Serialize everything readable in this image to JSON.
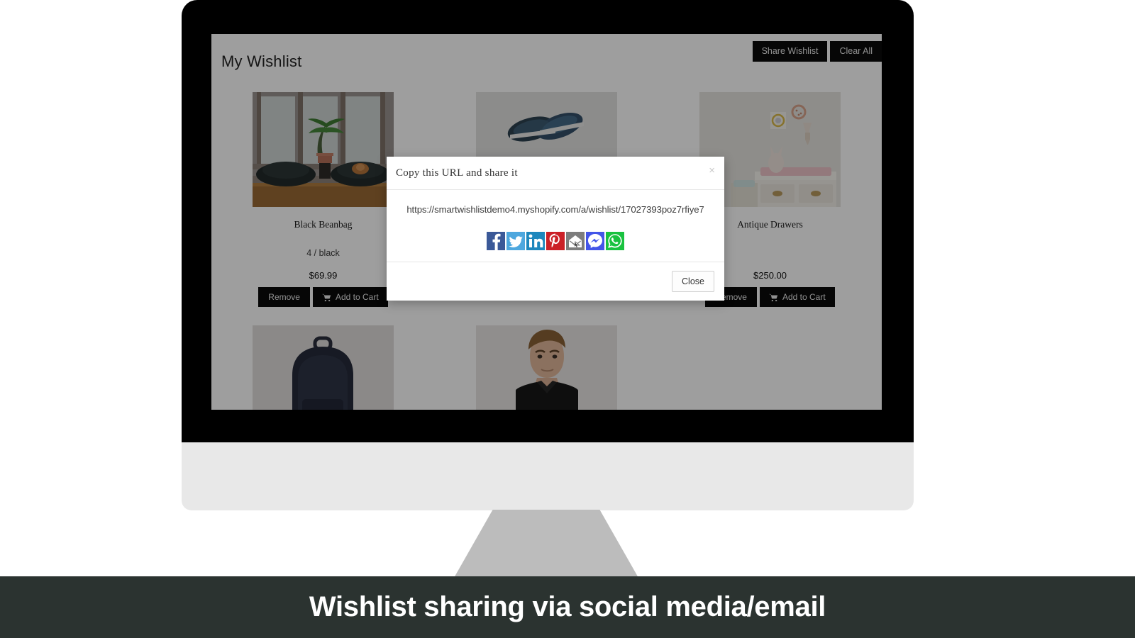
{
  "caption": {
    "text": "Wishlist sharing via social media/email"
  },
  "header": {
    "title": "My Wishlist",
    "share_button": "Share Wishlist",
    "clear_button": "Clear All"
  },
  "labels": {
    "remove": "Remove",
    "add_to_cart": "Add to Cart"
  },
  "products": [
    {
      "name": "Black Beanbag",
      "variant": "4 / black",
      "price": "$69.99",
      "image": "beanbag-room-photo"
    },
    {
      "name": "",
      "variant": "",
      "price": "",
      "image": "blue-shoes-photo"
    },
    {
      "name": "Antique Drawers",
      "variant": "",
      "price": "$250.00",
      "image": "nursery-drawers-photo"
    },
    {
      "name": "",
      "variant": "",
      "price": "",
      "image": "navy-backpack-photo"
    },
    {
      "name": "",
      "variant": "",
      "price": "",
      "image": "male-model-tshirt-photo"
    }
  ],
  "modal": {
    "title": "Copy this URL and share it",
    "url": "https://smartwishlistdemo4.myshopify.com/a/wishlist/17027393poz7rfiye7",
    "close_icon": "close-x-icon",
    "close_button": "Close",
    "social": [
      {
        "name": "facebook",
        "icon": "facebook-icon",
        "color": "#3b5998"
      },
      {
        "name": "twitter",
        "icon": "twitter-icon",
        "color": "#4da7de"
      },
      {
        "name": "linkedin",
        "icon": "linkedin-icon",
        "color": "#1d87bd"
      },
      {
        "name": "pinterest",
        "icon": "pinterest-icon",
        "color": "#cb2027"
      },
      {
        "name": "email",
        "icon": "email-icon",
        "color": "#7d7d7d"
      },
      {
        "name": "messenger",
        "icon": "messenger-icon",
        "color": "#4355e8"
      },
      {
        "name": "whatsapp",
        "icon": "whatsapp-icon",
        "color": "#19c23f"
      }
    ]
  },
  "colors": {
    "button_dark": "#0a0a0a",
    "caption_bg": "#2b3330",
    "monitor_frame": "#000000",
    "monitor_base": "#e8e8e8",
    "monitor_stand": "#bcbcbc"
  }
}
